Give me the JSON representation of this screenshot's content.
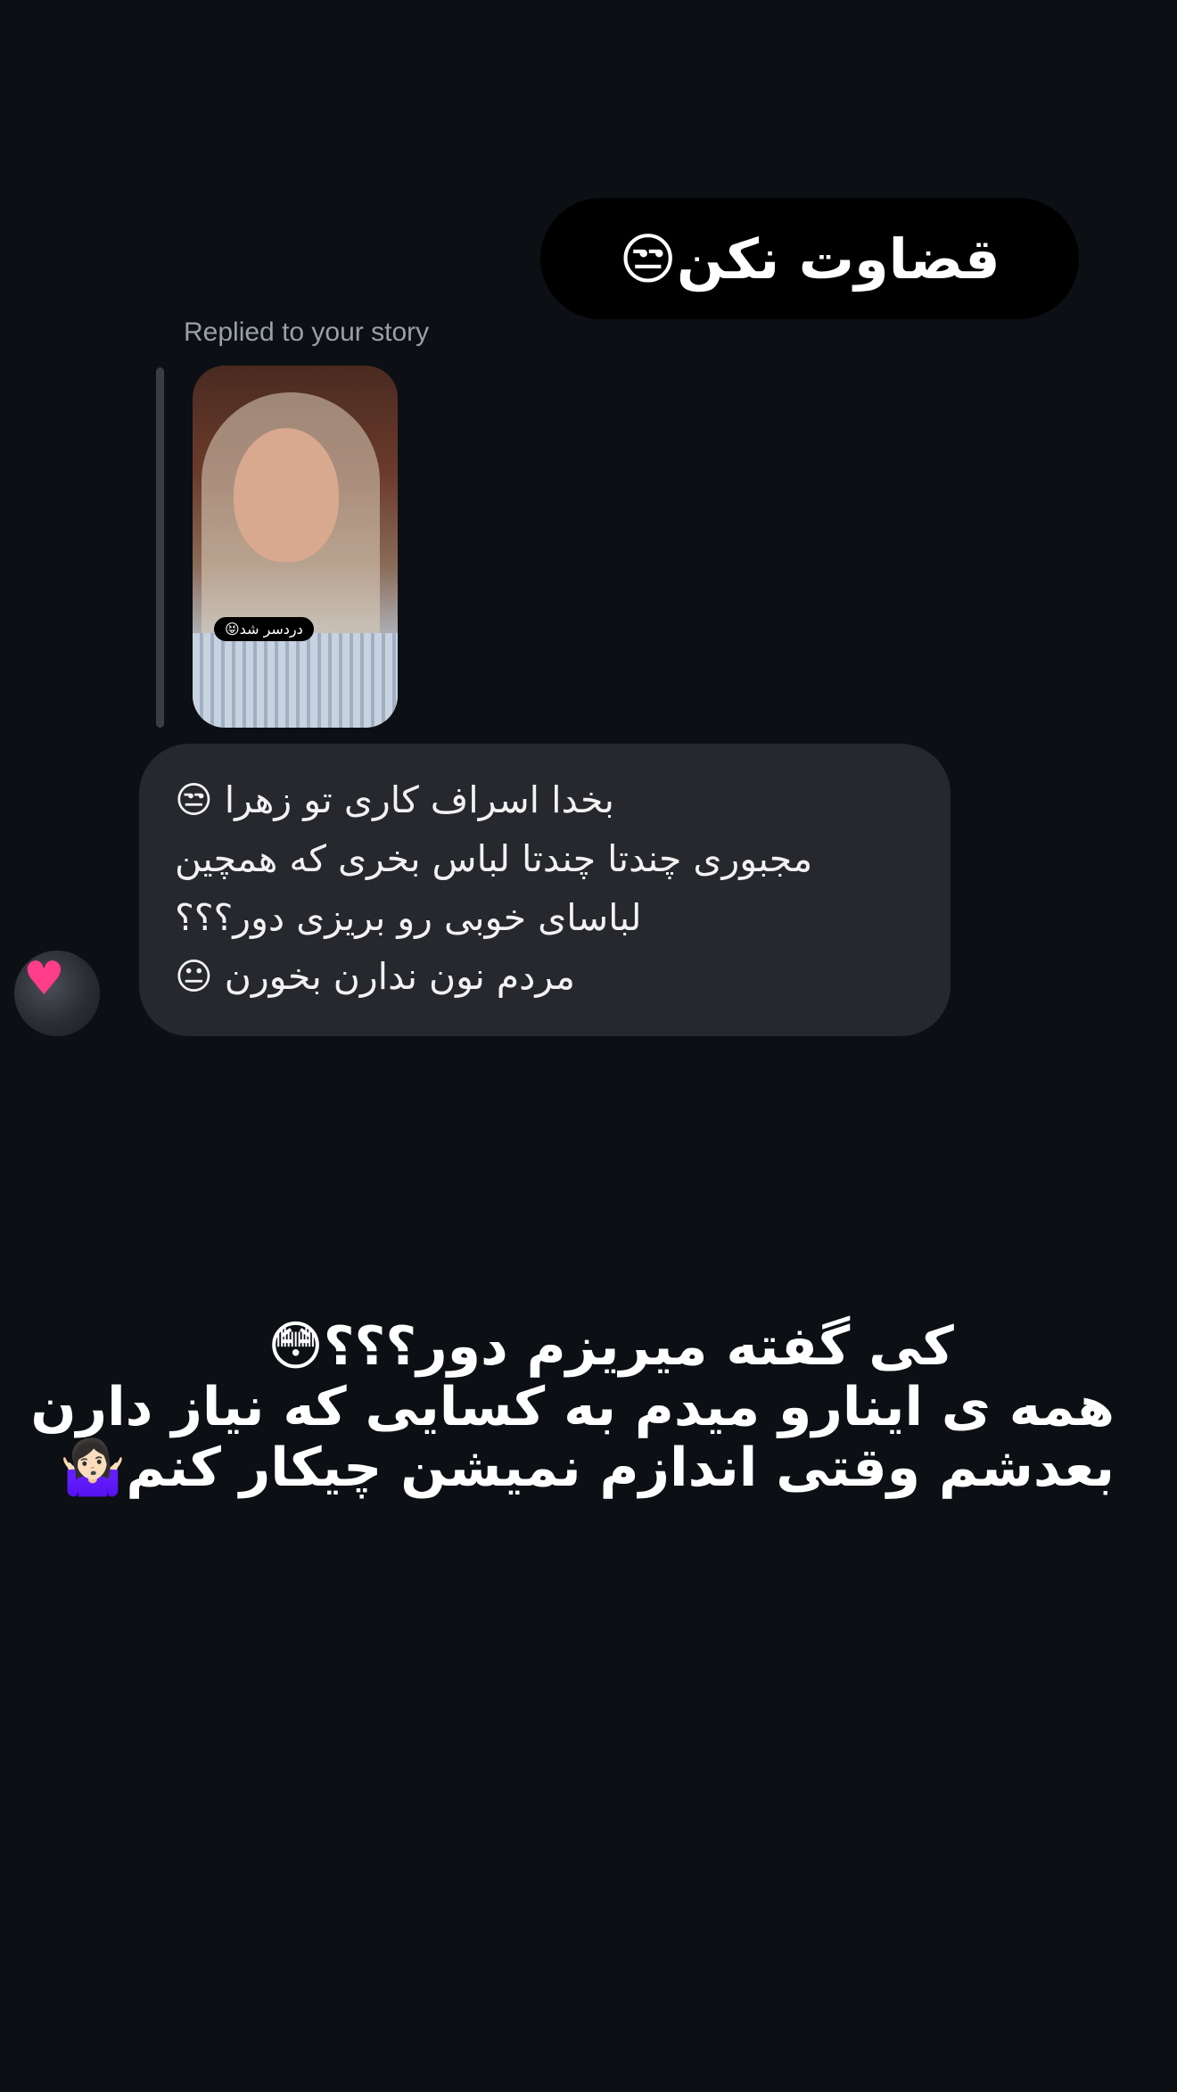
{
  "sent_message": {
    "text": "قضاوت نکن😒"
  },
  "reply_context": {
    "label": "Replied to your story",
    "story_sticker_text": "دردسر شد😝"
  },
  "received_message": {
    "lines": [
      "بخدا اسراف کاری تو زهرا 😒",
      "مجبوری چندتا چندتا لباس بخری که همچین",
      "لباسای خوبی رو بریزی دور؟؟؟",
      "مردم نون ندارن بخورن 😐"
    ]
  },
  "sender_avatar": {
    "icon": "pink-heart-icon"
  },
  "caption": {
    "lines": [
      "کی گفته میریزم دور؟؟؟😳",
      "همه ی اینارو میدم به کسایی که نیاز دارن",
      "بعدشم وقتی اندازم نمیشن چیکار کنم🤷🏻‍♀️"
    ]
  },
  "colors": {
    "background": "#0c0f14",
    "received_bubble": "#26282d",
    "sent_bubble": "#000000",
    "label_text": "#9aa0a8"
  }
}
